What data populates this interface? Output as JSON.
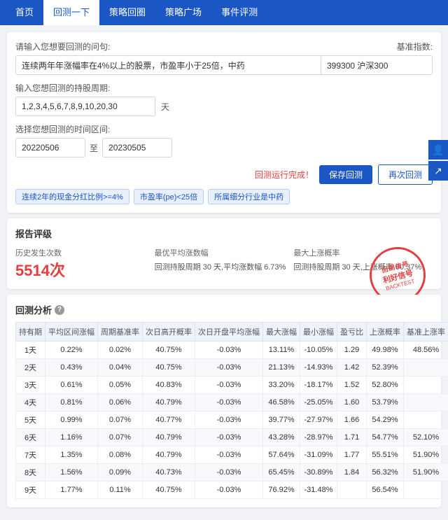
{
  "nav": {
    "items": [
      "首页",
      "回测一下",
      "策略回圈",
      "策略广场",
      "事件评测"
    ],
    "active": "回测一下"
  },
  "form": {
    "query_label": "请输入您想要回测的问句:",
    "query_value": "连续两年年涨幅率在4%以上的股票，市盈率小于25倍，中药",
    "period_label": "输入您想回测的持股周期:",
    "period_value": "1,2,3,4,5,6,7,8,9,10,20,30",
    "period_unit": "天",
    "time_label": "选择您想回测的时间区间:",
    "date_start": "20220506",
    "date_end": "20230505",
    "baseline_label": "基准指数:",
    "baseline_value": "399300 沪深300"
  },
  "actions": {
    "run_status": "回测运行完成！",
    "save_label": "保存回测",
    "rerun_label": "再次回测"
  },
  "tags": [
    "连续2年的现金分红比例>=4%",
    "市盈率(pe)<25倍",
    "所属细分行业是中药"
  ],
  "report": {
    "title": "报告评级",
    "hist_label": "历史发生次数",
    "hist_value": "5514次",
    "best_label": "最优平均涨数幅",
    "best_detail": "回测持股周期 30 天,平均涨数幅 6.73%",
    "max_label": "最大上涨概率",
    "max_detail": "回测持股周期 30 天,上涨概率 60.37%",
    "stamp_top": "回测信号",
    "stamp_main": "利好信号",
    "stamp_sub": "BACKTEST"
  },
  "analysis": {
    "title": "回测分析",
    "help": "?",
    "columns": [
      "持有期",
      "平均区间涨幅",
      "周期基准率",
      "次日高开概率",
      "次日开盘平均涨幅",
      "最大涨幅",
      "最小涨幅",
      "盈亏比",
      "上涨概率",
      "基准上涨率"
    ],
    "rows": [
      [
        "1天",
        "0.22%",
        "0.02%",
        "40.75%",
        "-0.03%",
        "13.11%",
        "-10.05%",
        "1.29",
        "49.98%",
        "48.56%"
      ],
      [
        "2天",
        "0.43%",
        "0.04%",
        "40.75%",
        "-0.03%",
        "21.13%",
        "-14.93%",
        "1.42",
        "52.39%",
        ""
      ],
      [
        "3天",
        "0.61%",
        "0.05%",
        "40.83%",
        "-0.03%",
        "33.20%",
        "-18.17%",
        "1.52",
        "52.80%",
        ""
      ],
      [
        "4天",
        "0.81%",
        "0.06%",
        "40.79%",
        "-0.03%",
        "46.58%",
        "-25.05%",
        "1.60",
        "53.79%",
        ""
      ],
      [
        "5天",
        "0.99%",
        "0.07%",
        "40.77%",
        "-0.03%",
        "39.77%",
        "-27.97%",
        "1.66",
        "54.29%",
        ""
      ],
      [
        "6天",
        "1.16%",
        "0.07%",
        "40.79%",
        "-0.03%",
        "43.28%",
        "-28.97%",
        "1.71",
        "54.77%",
        "52.10%"
      ],
      [
        "7天",
        "1.35%",
        "0.08%",
        "40.79%",
        "-0.03%",
        "57.64%",
        "-31.09%",
        "1.77",
        "55.51%",
        "51.90%"
      ],
      [
        "8天",
        "1.56%",
        "0.09%",
        "40.73%",
        "-0.03%",
        "65.45%",
        "-30.89%",
        "1.84",
        "56.32%",
        "51.90%"
      ],
      [
        "9天",
        "1.77%",
        "0.11%",
        "40.75%",
        "-0.03%",
        "76.92%",
        "-31.48%",
        "",
        "56.54%",
        ""
      ]
    ]
  }
}
